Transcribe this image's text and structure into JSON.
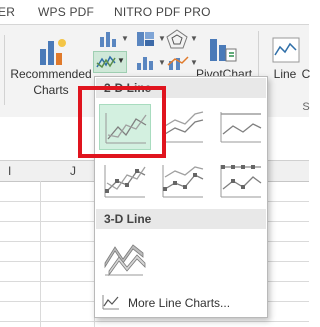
{
  "tabs": [
    "ER",
    "WPS PDF",
    "NITRO PDF PRO"
  ],
  "ribbon": {
    "recommended_line1": "Recommended",
    "recommended_line2": "Charts",
    "pivotchart_label": "PivotChart",
    "line_label": "Line",
    "col_label": "C",
    "group_initial": "S"
  },
  "columns": [
    "I",
    "J"
  ],
  "dropdown": {
    "section_2d": "2-D Line",
    "section_3d": "3-D Line",
    "more_label": "More Line Charts..."
  },
  "colors": {
    "highlight": "#e0141e",
    "selected_bg": "#d3f0e0",
    "chart_grey": "#8c8c8c"
  }
}
